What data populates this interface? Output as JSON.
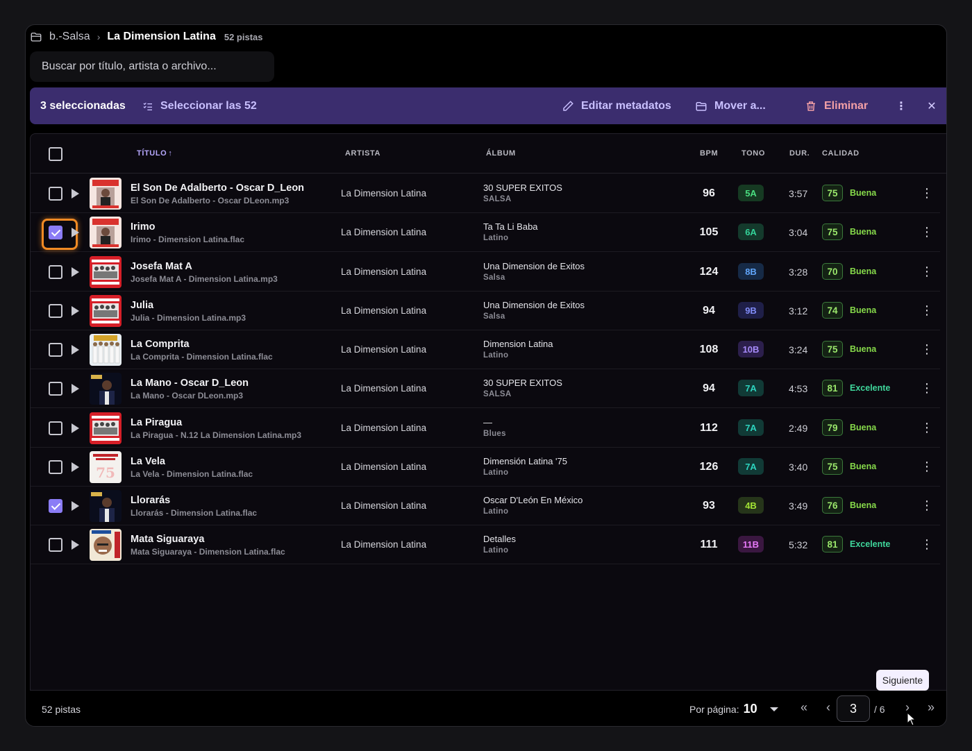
{
  "breadcrumb": {
    "root": "b.-Salsa",
    "separator": "›",
    "current": "La Dimension Latina",
    "count": "52 pistas"
  },
  "search": {
    "placeholder": "Buscar por título, artista o archivo..."
  },
  "selection_bar": {
    "count": "3 seleccionadas",
    "select_all": "Seleccionar las 52",
    "edit": "Editar metadatos",
    "move": "Mover a...",
    "delete": "Eliminar",
    "more_icon": "⋮",
    "close_icon": "✕"
  },
  "columns": {
    "title": "TÍTULO",
    "sort_icon": "↑",
    "artist": "ARTISTA",
    "album": "ÁLBUM",
    "bpm": "BPM",
    "key": "TONO",
    "duration": "DUR.",
    "quality": "CALIDAD"
  },
  "rows": [
    {
      "title": "El Son De Adalberto - Oscar D_Leon",
      "file": "El Son De Adalberto - Oscar DLeon.mp3",
      "artist": "La Dimension Latina",
      "album": "30 SUPER EXITOS",
      "genre": "SALSA",
      "bpm": "96",
      "key": "5A",
      "key_color": "#4ade80",
      "key_bg": "#163a22",
      "duration": "3:57",
      "score": "75",
      "quality": "Buena",
      "checked": false,
      "focused": false,
      "art": "oscar-red"
    },
    {
      "title": "Irimo",
      "file": "Irimo - Dimension Latina.flac",
      "artist": "La Dimension Latina",
      "album": "Ta Ta Li Baba",
      "genre": "Latino",
      "bpm": "105",
      "key": "6A",
      "key_color": "#34d399",
      "key_bg": "#143a2c",
      "duration": "3:04",
      "score": "75",
      "quality": "Buena",
      "checked": true,
      "focused": true,
      "art": "oscar-red"
    },
    {
      "title": "Josefa Mat A",
      "file": "Josefa Mat A - Dimension Latina.mp3",
      "artist": "La Dimension Latina",
      "album": "Una Dimension de Exitos",
      "genre": "Salsa",
      "bpm": "124",
      "key": "8B",
      "key_color": "#60a5fa",
      "key_bg": "#162a46",
      "duration": "3:28",
      "score": "70",
      "quality": "Buena",
      "checked": false,
      "focused": false,
      "art": "band-red"
    },
    {
      "title": "Julia",
      "file": "Julia - Dimension Latina.mp3",
      "artist": "La Dimension Latina",
      "album": "Una Dimension de Exitos",
      "genre": "Salsa",
      "bpm": "94",
      "key": "9B",
      "key_color": "#818cf8",
      "key_bg": "#1f1f48",
      "duration": "3:12",
      "score": "74",
      "quality": "Buena",
      "checked": false,
      "focused": false,
      "art": "band-red"
    },
    {
      "title": "La Comprita",
      "file": "La Comprita - Dimension Latina.flac",
      "artist": "La Dimension Latina",
      "album": "Dimension Latina",
      "genre": "Latino",
      "bpm": "108",
      "key": "10B",
      "key_color": "#a78bfa",
      "key_bg": "#2c1f4c",
      "duration": "3:24",
      "score": "75",
      "quality": "Buena",
      "checked": false,
      "focused": false,
      "art": "band-white"
    },
    {
      "title": "La Mano - Oscar D_Leon",
      "file": "La Mano - Oscar DLeon.mp3",
      "artist": "La Dimension Latina",
      "album": "30 SUPER EXITOS",
      "genre": "SALSA",
      "bpm": "94",
      "key": "7A",
      "key_color": "#2dd4bf",
      "key_bg": "#113a36",
      "duration": "4:53",
      "score": "81",
      "quality": "Excelente",
      "checked": false,
      "focused": false,
      "art": "dark-portrait"
    },
    {
      "title": "La Piragua",
      "file": "La Piragua - N.12 La Dimension Latina.mp3",
      "artist": "La Dimension Latina",
      "album": "—",
      "genre": "Blues",
      "bpm": "112",
      "key": "7A",
      "key_color": "#2dd4bf",
      "key_bg": "#113a36",
      "duration": "2:49",
      "score": "79",
      "quality": "Buena",
      "checked": false,
      "focused": false,
      "art": "band-red"
    },
    {
      "title": "La Vela",
      "file": "La Vela - Dimension Latina.flac",
      "artist": "La Dimension Latina",
      "album": "Dimensión Latina '75",
      "genre": "Latino",
      "bpm": "126",
      "key": "7A",
      "key_color": "#2dd4bf",
      "key_bg": "#113a36",
      "duration": "3:40",
      "score": "75",
      "quality": "Buena",
      "checked": false,
      "focused": false,
      "art": "text-75"
    },
    {
      "title": "Llorarás",
      "file": "Llorarás - Dimension Latina.flac",
      "artist": "La Dimension Latina",
      "album": "Oscar D'León En México",
      "genre": "Latino",
      "bpm": "93",
      "key": "4B",
      "key_color": "#a3e635",
      "key_bg": "#26351a",
      "duration": "3:49",
      "score": "76",
      "quality": "Buena",
      "checked": true,
      "focused": false,
      "art": "dark-portrait"
    },
    {
      "title": "Mata Siguaraya",
      "file": "Mata Siguaraya - Dimension Latina.flac",
      "artist": "La Dimension Latina",
      "album": "Detalles",
      "genre": "Latino",
      "bpm": "111",
      "key": "11B",
      "key_color": "#e879f9",
      "key_bg": "#3a1740",
      "duration": "5:32",
      "score": "81",
      "quality": "Excelente",
      "checked": false,
      "focused": false,
      "art": "face-portrait"
    }
  ],
  "footer": {
    "total": "52 pistas",
    "per_page_label": "Por página:",
    "per_page_value": "10",
    "first_icon": "«",
    "prev_icon": "‹",
    "current_page": "3",
    "total_pages": "/ 6",
    "next_icon": "›",
    "last_icon": "»"
  },
  "tooltip": "Siguiente",
  "colors": {
    "accent": "#8b7cf6",
    "selection_bar": "#3b2d6e",
    "delete": "#f3a0a6",
    "quality_good": "#86d94a",
    "quality_excellent": "#3fd69b",
    "focus_ring": "#f08a24"
  }
}
